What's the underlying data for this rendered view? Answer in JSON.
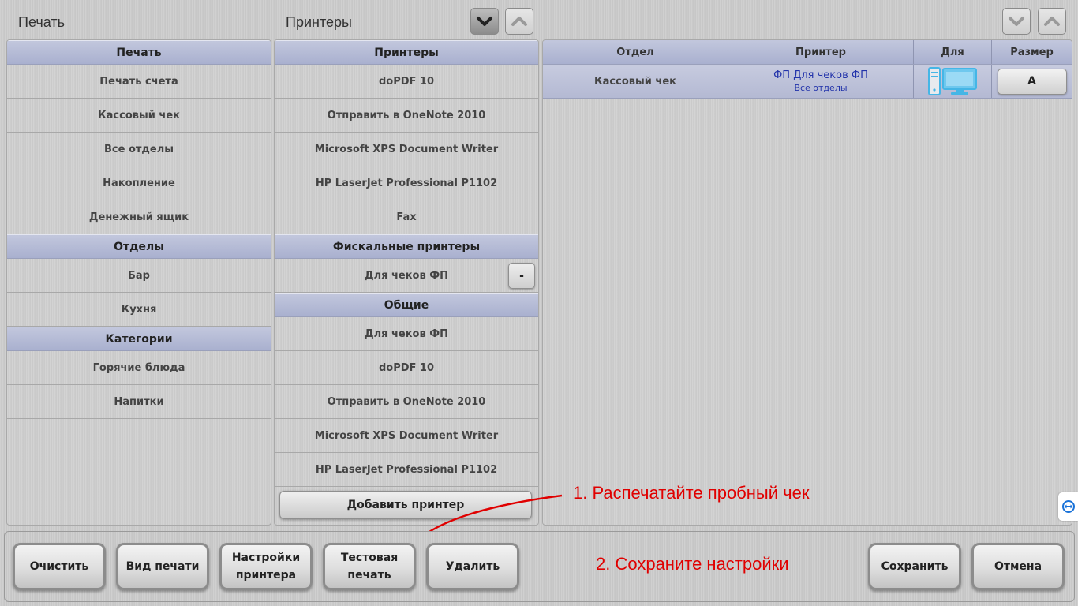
{
  "header": {
    "left_title": "Печать",
    "middle_title": "Принтеры"
  },
  "left_panel": {
    "sections": [
      {
        "title": "Печать",
        "items": [
          "Печать счета",
          "Кассовый чек",
          "Все отделы",
          "Накопление",
          "Денежный ящик"
        ]
      },
      {
        "title": "Отделы",
        "items": [
          "Бар",
          "Кухня"
        ]
      },
      {
        "title": "Категории",
        "items": [
          "Горячие блюда",
          "Напитки"
        ]
      }
    ]
  },
  "middle_panel": {
    "printers_title": "Принтеры",
    "printers": [
      "doPDF 10",
      "Отправить в OneNote 2010",
      "Microsoft XPS Document Writer",
      "HP LaserJet Professional P1102",
      "Fax"
    ],
    "fiscal_title": "Фискальные принтеры",
    "fiscal_item": "Для чеков ФП",
    "fiscal_item_button": "-",
    "common_title": "Общие",
    "common": [
      "Для чеков ФП",
      "doPDF 10",
      "Отправить в OneNote 2010",
      "Microsoft XPS Document Writer",
      "HP LaserJet Professional P1102"
    ],
    "add_printer": "Добавить принтер"
  },
  "right_table": {
    "columns": [
      "Отдел",
      "Принтер",
      "Для",
      "Размер"
    ],
    "rows": [
      {
        "department": "Кассовый чек",
        "printer": "ФП Для чеков ФП",
        "printer_sub": "Все отделы",
        "for_icon": "computer-monitor-icon",
        "size": "A"
      }
    ]
  },
  "bottom_buttons": {
    "clear": "Очистить",
    "print_view": "Вид печати",
    "printer_settings": "Настройки\nпринтера",
    "test_print": "Тестовая\nпечать",
    "delete": "Удалить",
    "save": "Сохранить",
    "cancel": "Отмена"
  },
  "annotations": {
    "step1": "1. Распечатайте пробный чек",
    "step2": "2. Сохраните настройки"
  },
  "colors": {
    "section_header": "#a9b0cf",
    "annotation": "#e00000",
    "printer_link": "#2233aa",
    "monitor_icon": "#45b6e6"
  }
}
